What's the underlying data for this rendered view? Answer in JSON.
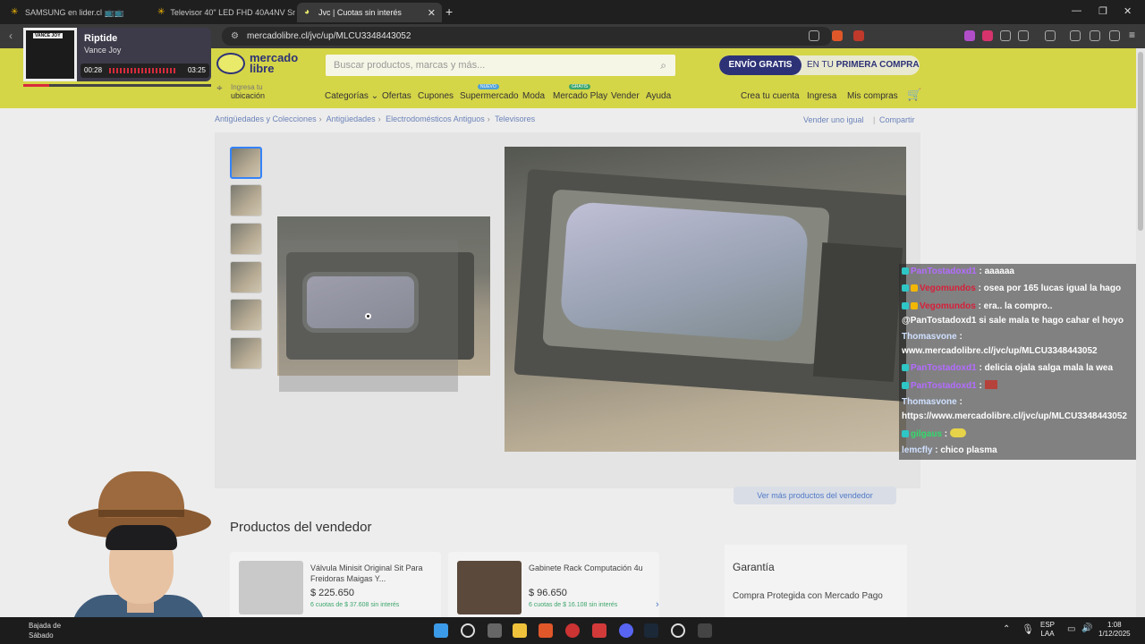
{
  "browser": {
    "tabs": [
      {
        "label": "SAMSUNG en lider.cl 📺📺"
      },
      {
        "label": "Televisor 40\" LED FHD 40A4NV Sma"
      },
      {
        "label": "Jvc | Cuotas sin interés"
      }
    ],
    "url": "mercadolibre.cl/jvc/up/MLCU3348443052"
  },
  "music": {
    "title": "Riptide",
    "artist": "Vance Joy",
    "art_text": "VANCE JOY",
    "elapsed": "00:28",
    "duration": "03:25",
    "progress": 0.14
  },
  "header": {
    "logo_line1": "mercado",
    "logo_line2": "libre",
    "search_placeholder": "Buscar productos, marcas y más...",
    "envio_a": "ENVÍO GRATIS",
    "envio_b1": "EN TU ",
    "envio_b2": "PRIMERA COMPRA",
    "loc_line1": "Ingresa tu",
    "loc_line2": "ubicación",
    "nav": [
      "Categorías ⌄",
      "Ofertas",
      "Cupones",
      "Supermercado",
      "Moda",
      "Mercado Play",
      "Vender",
      "Ayuda"
    ],
    "badge_nuevo": "NUEVO",
    "badge_gratis": "GRATIS",
    "account": [
      "Crea tu cuenta",
      "Ingresa",
      "Mis compras"
    ]
  },
  "breadcrumb": [
    "Antigüedades y Colecciones",
    "Antigüedades",
    "Electrodomésticos Antiguos",
    "Televisores"
  ],
  "actions": {
    "sell_same": "Vender uno igual",
    "share": "Compartir"
  },
  "seller_button": "Ver más productos del vendedor",
  "products_title": "Productos del vendedor",
  "products": [
    {
      "title": "Válvula Minisit Original Sit Para Freidoras Maigas Y...",
      "price": "$ 225.650",
      "installments": "6 cuotas de $ 37.608 sin interés"
    },
    {
      "title": "Gabinete Rack Computación 4u",
      "price": "$ 96.650",
      "installments": "6 cuotas de $ 16.108 sin interés"
    }
  ],
  "guarantee": {
    "title": "Garantía",
    "subtitle": "Compra Protegida con Mercado Pago"
  },
  "chat": [
    {
      "user": "PanTostadoxd1",
      "msg": ": aaaaaa",
      "color": "#b36cff"
    },
    {
      "user": "Vegomundos",
      "msg": ": osea por 165 lucas igual la hago",
      "color": "#d6203a"
    },
    {
      "user": "Vegomundos",
      "msg": ": era.. la compro..",
      "color": "#d6203a"
    },
    {
      "user": "",
      "msg": "@PanTostadoxd1 si sale mala te hago cahar el hoyo",
      "color": "#ffffff"
    },
    {
      "user": "Thomasvone",
      "msg": " :",
      "color": "#cfe0ff"
    },
    {
      "user": "",
      "msg": "www.mercadolibre.cl/jvc/up/MLCU3348443052",
      "color": "#ffffff"
    },
    {
      "user": "PanTostadoxd1",
      "msg": ": delicia ojala salga mala la wea",
      "color": "#b36cff"
    },
    {
      "user": "PanTostadoxd1",
      "msg": ":",
      "color": "#b36cff"
    },
    {
      "user": "Thomasvone",
      "msg": " :",
      "color": "#cfe0ff"
    },
    {
      "user": "",
      "msg": "https://www.mercadolibre.cl/jvc/up/MLCU3348443052",
      "color": "#ffffff"
    },
    {
      "user": "gilgaus",
      "msg": ":",
      "color": "#34d96b"
    },
    {
      "user": "lemcfly",
      "msg": ": chico plasma",
      "color": "#cfe0ff"
    }
  ],
  "taskbar": {
    "weather_1": "Bajada de",
    "weather_2": "Sábado",
    "lang_1": "ESP",
    "lang_2": "LAA",
    "time": "1:08",
    "date": "1/12/2025"
  }
}
